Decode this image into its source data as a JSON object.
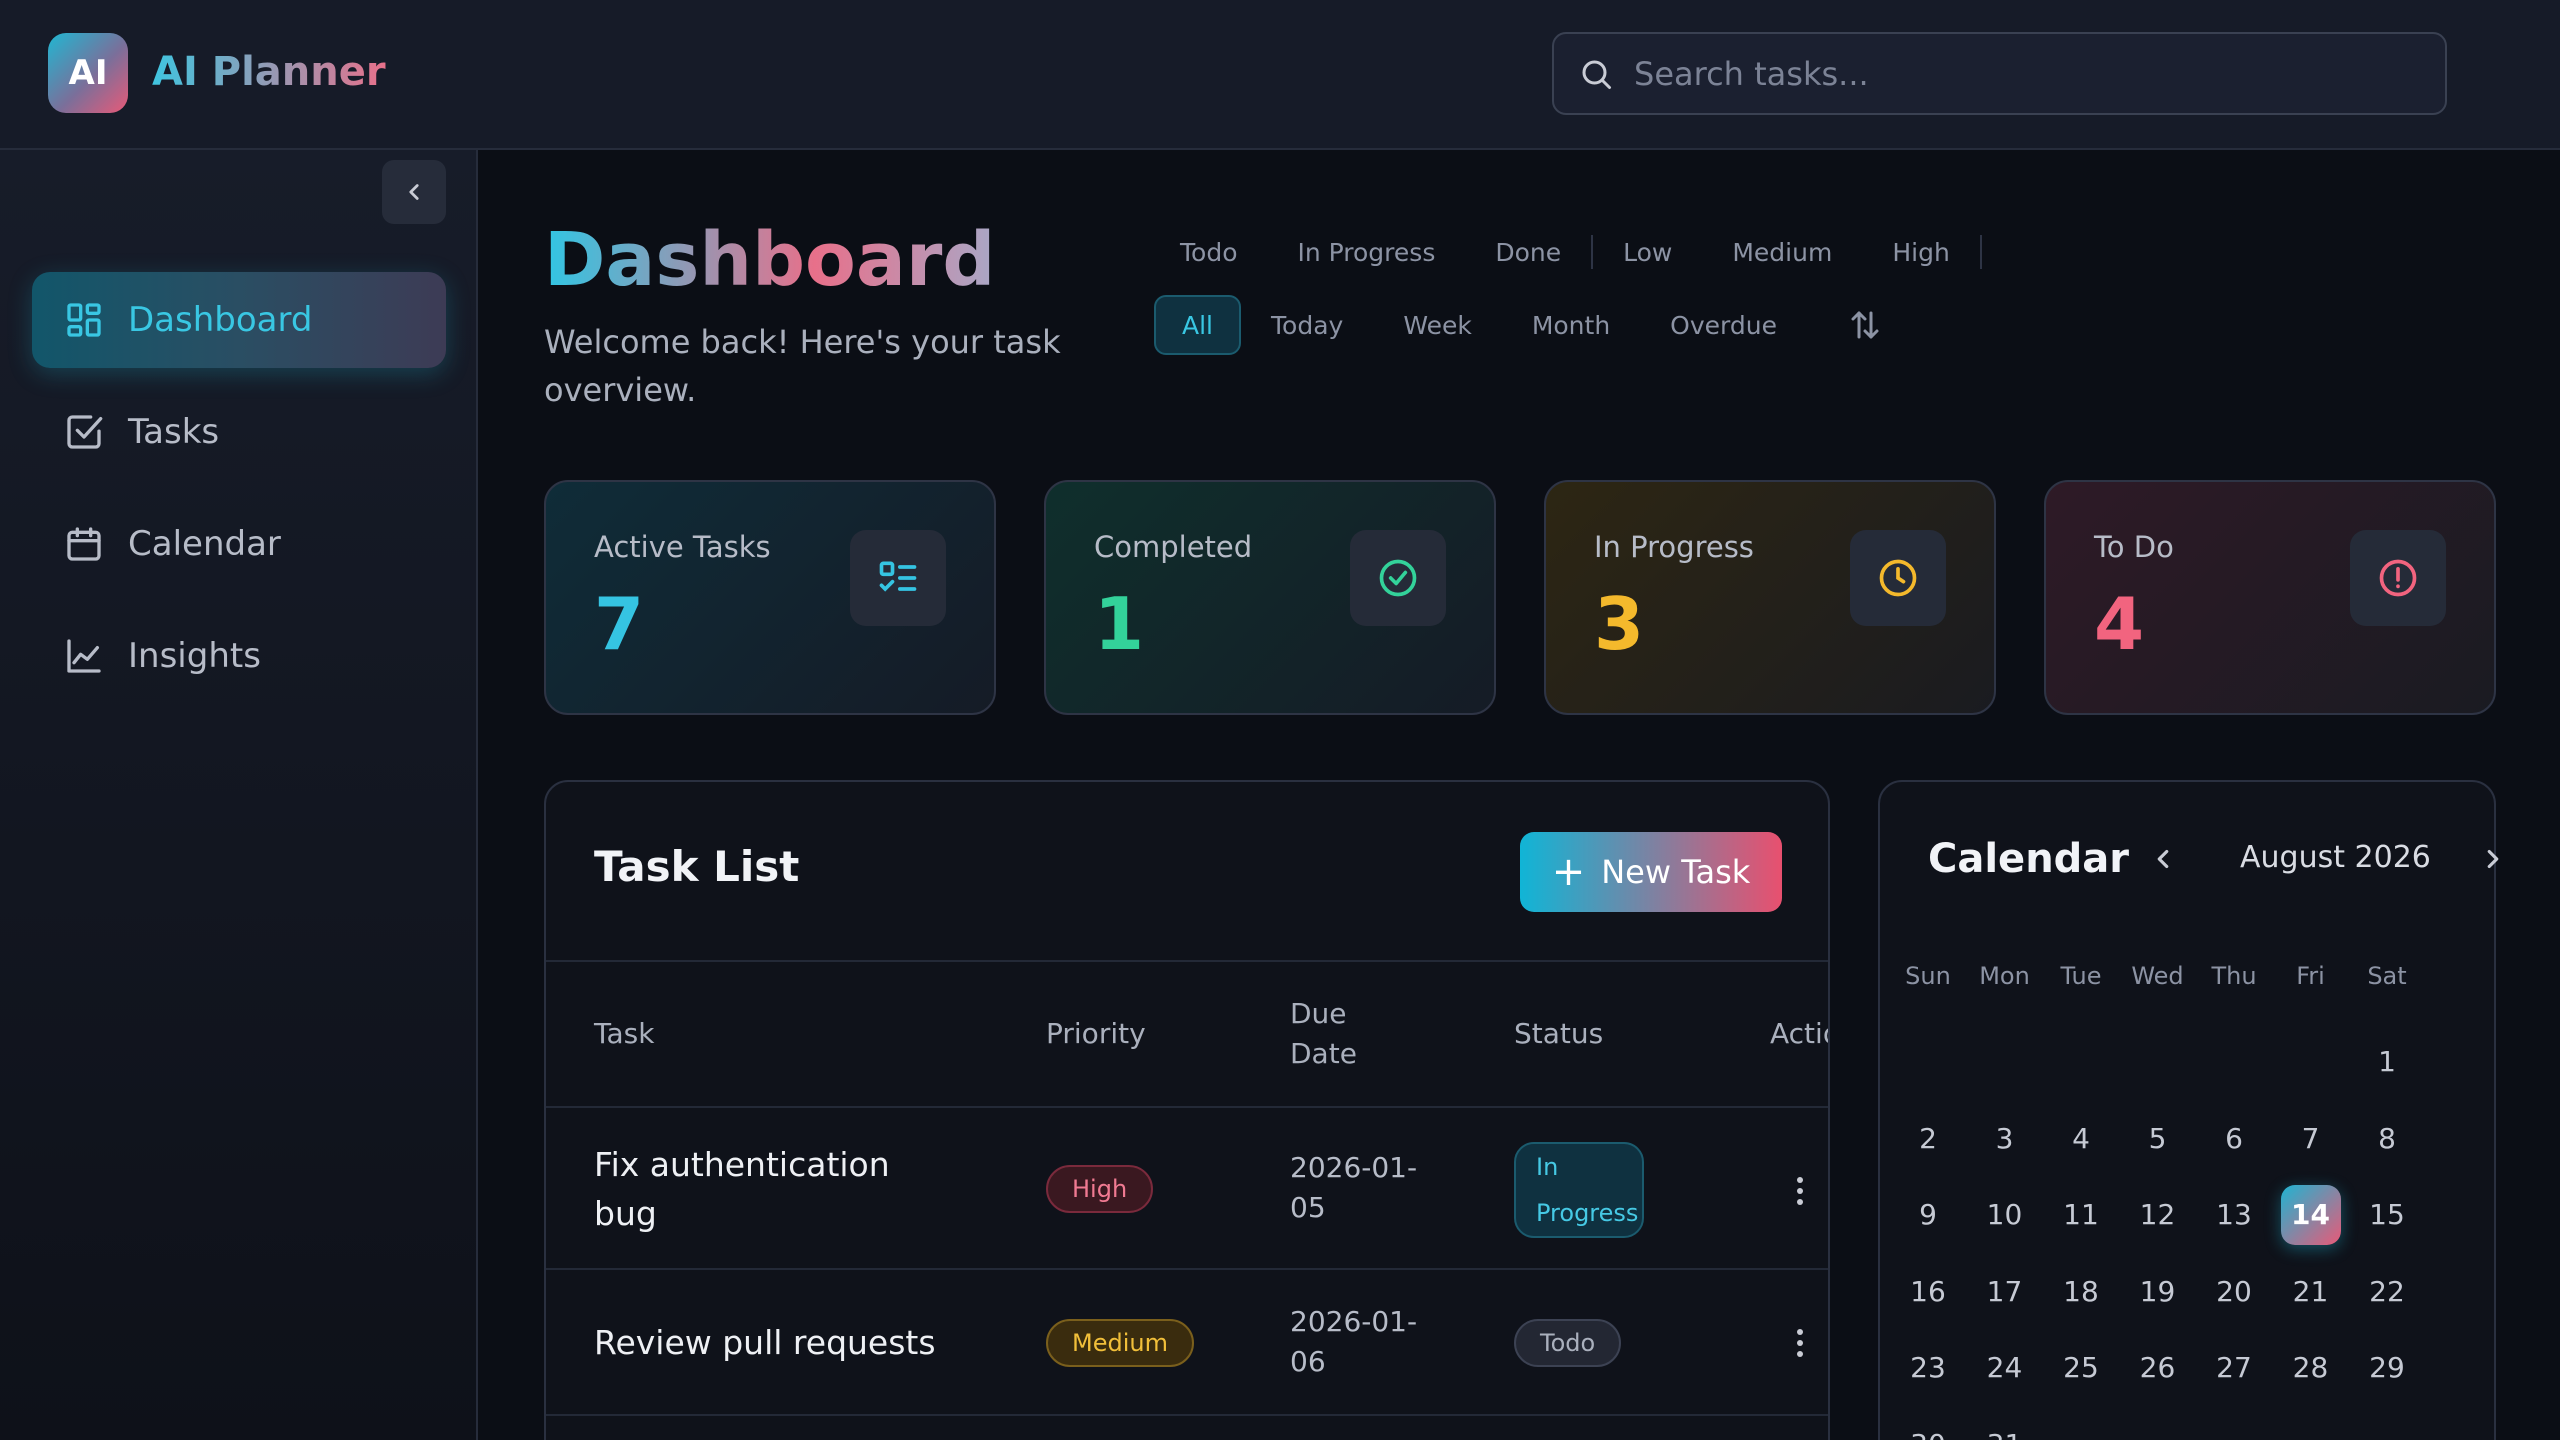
{
  "app": {
    "logo_text": "AI",
    "title": "AI Planner"
  },
  "search": {
    "placeholder": "Search tasks..."
  },
  "sidebar": {
    "items": [
      {
        "label": "Dashboard",
        "icon": "dashboard-icon",
        "active": true
      },
      {
        "label": "Tasks",
        "icon": "checkbox-icon"
      },
      {
        "label": "Calendar",
        "icon": "calendar-icon"
      },
      {
        "label": "Insights",
        "icon": "chart-line-icon"
      }
    ]
  },
  "page": {
    "title": "Dashboard",
    "subtitle": "Welcome back! Here's your task overview."
  },
  "filters": {
    "status": [
      "Todo",
      "In Progress",
      "Done"
    ],
    "priority": [
      "Low",
      "Medium",
      "High"
    ],
    "range": [
      "All",
      "Today",
      "Week",
      "Month",
      "Overdue"
    ],
    "active_range": "All"
  },
  "stats": [
    {
      "label": "Active Tasks",
      "value": "7",
      "color": "#35c4e2",
      "icon": "list-icon"
    },
    {
      "label": "Completed",
      "value": "1",
      "color": "#33d29a",
      "icon": "check-circle-icon"
    },
    {
      "label": "In Progress",
      "value": "3",
      "color": "#f4b92c",
      "icon": "clock-icon"
    },
    {
      "label": "To Do",
      "value": "4",
      "color": "#f2647f",
      "icon": "alert-circle-icon"
    }
  ],
  "task_list": {
    "title": "Task List",
    "new_task_label": "New Task",
    "columns": {
      "task": "Task",
      "priority": "Priority",
      "due_date": "Due Date",
      "status": "Status",
      "actions": "Actions"
    },
    "rows": [
      {
        "name": "Fix authentication bug",
        "priority": "High",
        "due": "2026-01-05",
        "status": "In Progress"
      },
      {
        "name": "Review pull requests",
        "priority": "Medium",
        "due": "2026-01-06",
        "status": "Todo"
      }
    ]
  },
  "calendar": {
    "title": "Calendar",
    "month_label": "August 2026",
    "weekdays": [
      "Sun",
      "Mon",
      "Tue",
      "Wed",
      "Thu",
      "Fri",
      "Sat"
    ],
    "first_weekday_index": 6,
    "days_in_month": 31,
    "today": 14
  }
}
